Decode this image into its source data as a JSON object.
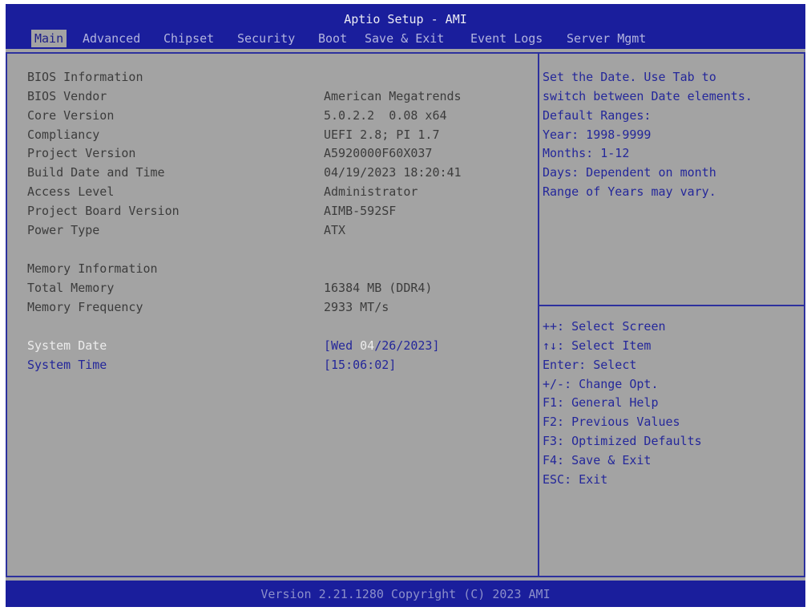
{
  "header": {
    "title": "Aptio Setup - AMI",
    "tabs": [
      "Main",
      "Advanced",
      "Chipset",
      "Security",
      "Boot",
      "Save & Exit",
      "Event Logs",
      "Server Mgmt"
    ],
    "active_tab": "Main"
  },
  "bios_info": {
    "heading": "BIOS Information",
    "rows": [
      {
        "label": "BIOS Vendor",
        "value": "American Megatrends"
      },
      {
        "label": "Core Version",
        "value": "5.0.2.2  0.08 x64"
      },
      {
        "label": "Compliancy",
        "value": "UEFI 2.8; PI 1.7"
      },
      {
        "label": "Project Version",
        "value": "A5920000F60X037"
      },
      {
        "label": "Build Date and Time",
        "value": "04/19/2023 18:20:41"
      },
      {
        "label": "Access Level",
        "value": "Administrator"
      },
      {
        "label": "Project Board Version",
        "value": "AIMB-592SF"
      },
      {
        "label": "Power Type",
        "value": "ATX"
      }
    ]
  },
  "memory_info": {
    "heading": "Memory Information",
    "rows": [
      {
        "label": "Total Memory",
        "value": "16384 MB (DDR4)"
      },
      {
        "label": "Memory Frequency",
        "value": "2933 MT/s"
      }
    ]
  },
  "system_date": {
    "label": "System Date",
    "prefix": "[Wed ",
    "month": "04",
    "suffix": "/26/2023]"
  },
  "system_time": {
    "label": "System Time",
    "value": "[15:06:02]"
  },
  "help_text": [
    "Set the Date. Use Tab to",
    "switch between Date elements.",
    "Default Ranges:",
    "Year: 1998-9999",
    "Months: 1-12",
    "Days: Dependent on month",
    "Range of Years may vary."
  ],
  "key_help": [
    "++: Select Screen",
    "↑↓: Select Item",
    "Enter: Select",
    "+/-: Change Opt.",
    "F1: General Help",
    "F2: Previous Values",
    "F3: Optimized Defaults",
    "F4: Save & Exit",
    "ESC: Exit"
  ],
  "footer": {
    "text": "Version 2.21.1280 Copyright (C) 2023 AMI"
  },
  "colors": {
    "title_bar": "#1a1e9c",
    "panel": "#a3a3a3",
    "selectable_text": "#24279a",
    "highlight_text": "#ececec",
    "border": "#2d319e"
  }
}
